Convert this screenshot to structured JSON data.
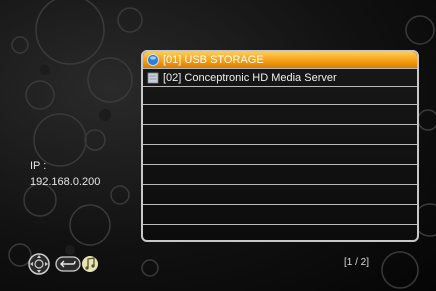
{
  "ip": {
    "label": "IP :",
    "value": "192.168.0.200"
  },
  "list": {
    "items": [
      {
        "label": "[01] USB STORAGE",
        "icon": "usb-storage-icon",
        "selected": true
      },
      {
        "label": "[02] Conceptronic HD Media Server",
        "icon": "media-server-icon",
        "selected": false
      }
    ],
    "empty_rows": 8
  },
  "pagination": "[1 / 2]",
  "colors": {
    "selection": "#f39a10",
    "background": "#111111",
    "border": "#c8c8c8"
  },
  "nav_icons": [
    "dpad-icon",
    "back-button-icon",
    "music-note-icon"
  ]
}
